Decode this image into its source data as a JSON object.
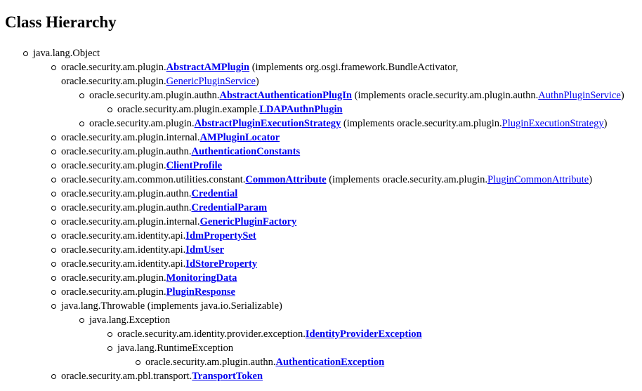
{
  "title": "Class Hierarchy",
  "rows": [
    {
      "pre": "java.lang.Object",
      "link": "",
      "mid": "",
      "link2": "",
      "post": ""
    },
    {
      "pre": "oracle.security.am.plugin.",
      "link": "AbstractAMPlugin",
      "mid": " (implements org.osgi.framework.BundleActivator,",
      "link2": "",
      "post": ""
    },
    {
      "pre": "oracle.security.am.plugin.",
      "link": "",
      "mid": "",
      "link2": "GenericPluginService",
      "post": ")"
    },
    {
      "pre": "oracle.security.am.plugin.authn.",
      "link": "AbstractAuthenticationPlugIn",
      "mid": " (implements oracle.security.am.plugin.authn.",
      "link2": "AuthnPluginService",
      "post": ")"
    },
    {
      "pre": "oracle.security.am.plugin.example.",
      "link": "LDAPAuthnPlugin",
      "mid": "",
      "link2": "",
      "post": ""
    },
    {
      "pre": "oracle.security.am.plugin.",
      "link": "AbstractPluginExecutionStrategy",
      "mid": " (implements oracle.security.am.plugin.",
      "link2": "PluginExecutionStrategy",
      "post": ")"
    },
    {
      "pre": "oracle.security.am.plugin.internal.",
      "link": "AMPluginLocator",
      "mid": "",
      "link2": "",
      "post": ""
    },
    {
      "pre": "oracle.security.am.plugin.authn.",
      "link": "AuthenticationConstants",
      "mid": "",
      "link2": "",
      "post": ""
    },
    {
      "pre": "oracle.security.am.plugin.",
      "link": "ClientProfile",
      "mid": "",
      "link2": "",
      "post": ""
    },
    {
      "pre": "oracle.security.am.common.utilities.constant.",
      "link": "CommonAttribute",
      "mid": " (implements oracle.security.am.plugin.",
      "link2": "PluginCommonAttribute",
      "post": ")"
    },
    {
      "pre": "oracle.security.am.plugin.authn.",
      "link": "Credential",
      "mid": "",
      "link2": "",
      "post": ""
    },
    {
      "pre": "oracle.security.am.plugin.authn.",
      "link": "CredentialParam",
      "mid": "",
      "link2": "",
      "post": ""
    },
    {
      "pre": "oracle.security.am.plugin.internal.",
      "link": "GenericPluginFactory",
      "mid": "",
      "link2": "",
      "post": ""
    },
    {
      "pre": "oracle.security.am.identity.api.",
      "link": "IdmPropertySet",
      "mid": "",
      "link2": "",
      "post": ""
    },
    {
      "pre": "oracle.security.am.identity.api.",
      "link": "IdmUser",
      "mid": "",
      "link2": "",
      "post": ""
    },
    {
      "pre": "oracle.security.am.identity.api.",
      "link": "IdStoreProperty",
      "mid": "",
      "link2": "",
      "post": ""
    },
    {
      "pre": "oracle.security.am.plugin.",
      "link": "MonitoringData",
      "mid": "",
      "link2": "",
      "post": ""
    },
    {
      "pre": "oracle.security.am.plugin.",
      "link": "PluginResponse",
      "mid": "",
      "link2": "",
      "post": ""
    },
    {
      "pre": "java.lang.Throwable (implements java.io.Serializable)",
      "link": "",
      "mid": "",
      "link2": "",
      "post": ""
    },
    {
      "pre": "java.lang.Exception",
      "link": "",
      "mid": "",
      "link2": "",
      "post": ""
    },
    {
      "pre": "oracle.security.am.identity.provider.exception.",
      "link": "IdentityProviderException",
      "mid": "",
      "link2": "",
      "post": ""
    },
    {
      "pre": "java.lang.RuntimeException",
      "link": "",
      "mid": "",
      "link2": "",
      "post": ""
    },
    {
      "pre": "oracle.security.am.plugin.authn.",
      "link": "AuthenticationException",
      "mid": "",
      "link2": "",
      "post": ""
    },
    {
      "pre": "oracle.security.am.pbl.transport.",
      "link": "TransportToken",
      "mid": "",
      "link2": "",
      "post": ""
    }
  ]
}
